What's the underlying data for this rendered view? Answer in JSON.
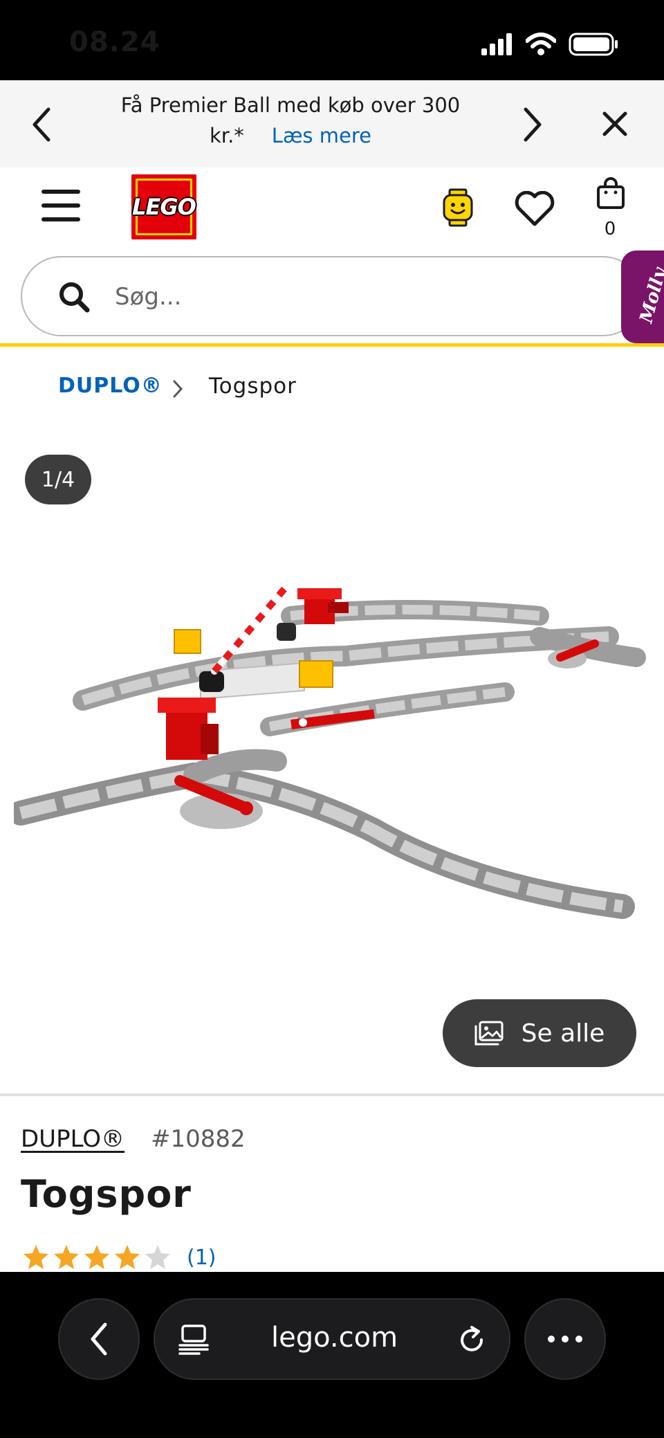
{
  "status_bar": {
    "time": "08.24"
  },
  "promo": {
    "text": "Få Premier Ball med køb over 300 kr.*",
    "link": "Læs mere"
  },
  "header": {
    "logo_text": "LEGO",
    "cart_count": "0"
  },
  "search": {
    "placeholder": "Søg..."
  },
  "assistant": {
    "label": "Molly"
  },
  "breadcrumb": {
    "parent": "DUPLO®",
    "current": "Togspor"
  },
  "gallery": {
    "counter": "1/4",
    "see_all_label": "Se alle"
  },
  "product": {
    "theme": "DUPLO®",
    "number": "#10882",
    "title": "Togspor",
    "rating": 4,
    "rating_max": 5,
    "review_count": "(1)"
  },
  "browser": {
    "url": "lego.com"
  },
  "colors": {
    "lego_red": "#e3000b",
    "lego_yellow": "#ffcf00",
    "link_blue": "#0062b8",
    "molly_purple": "#7a1469",
    "star_orange": "#f5a623"
  }
}
